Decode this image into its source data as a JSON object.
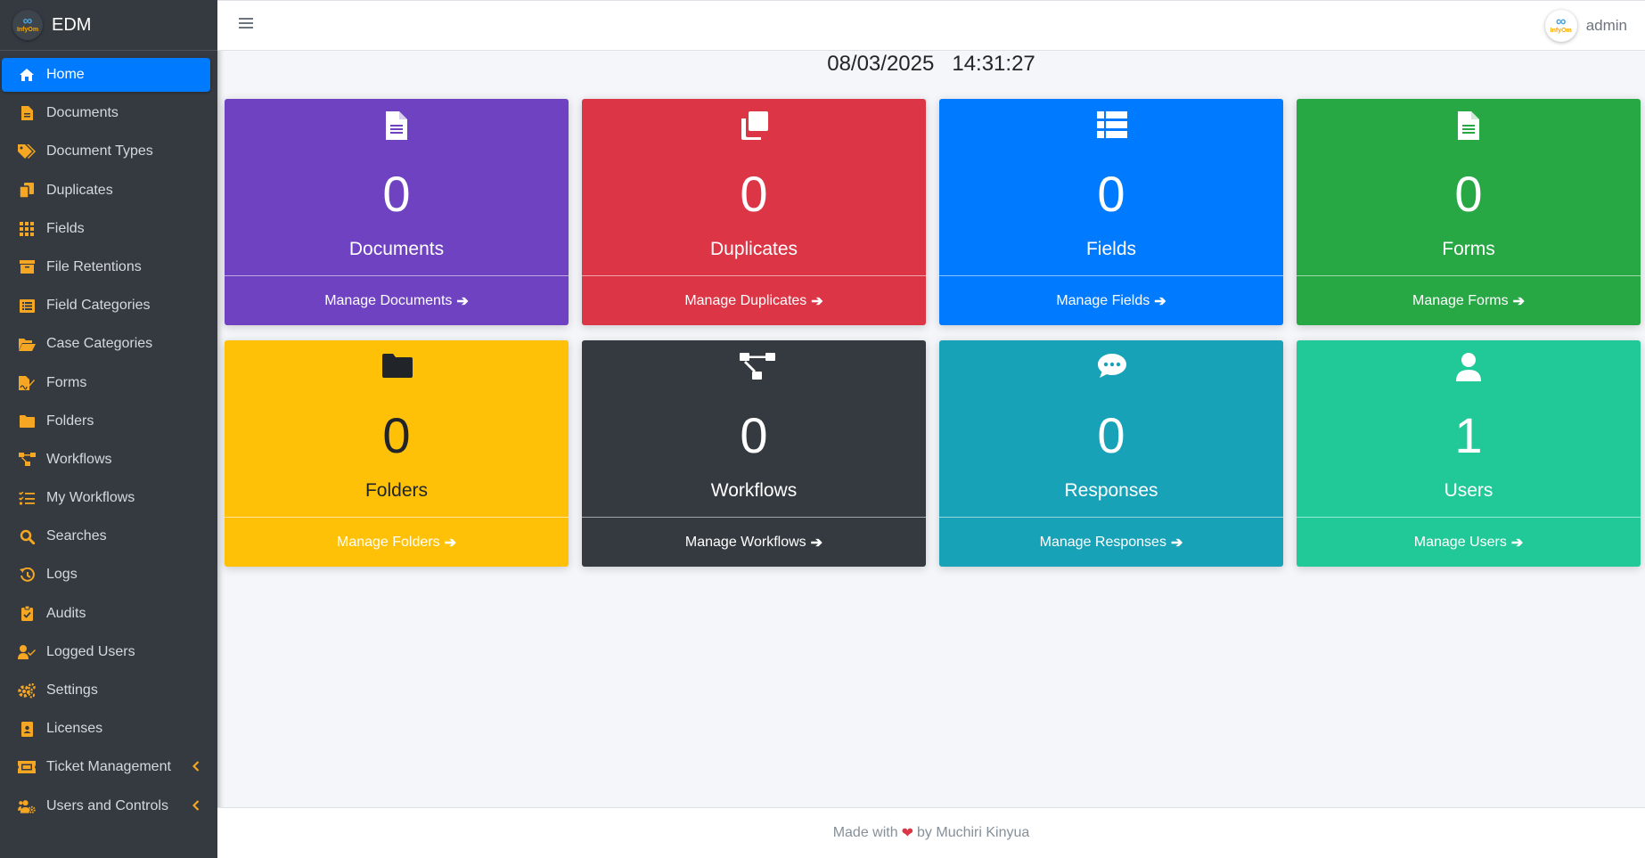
{
  "brand": {
    "name": "EDM",
    "logo_text": "InfyOm"
  },
  "sidebar": {
    "items": [
      {
        "label": "Home",
        "icon": "home-icon",
        "active": true
      },
      {
        "label": "Documents",
        "icon": "file-icon"
      },
      {
        "label": "Document Types",
        "icon": "tags-icon"
      },
      {
        "label": "Duplicates",
        "icon": "copy-icon"
      },
      {
        "label": "Fields",
        "icon": "grid-icon"
      },
      {
        "label": "File Retentions",
        "icon": "archive-icon"
      },
      {
        "label": "Field Categories",
        "icon": "list-alt-icon"
      },
      {
        "label": "Case Categories",
        "icon": "folder-open-icon"
      },
      {
        "label": "Forms",
        "icon": "file-signature-icon"
      },
      {
        "label": "Folders",
        "icon": "folder-icon"
      },
      {
        "label": "Workflows",
        "icon": "sitemap-icon"
      },
      {
        "label": "My Workflows",
        "icon": "tasks-icon"
      },
      {
        "label": "Searches",
        "icon": "search-icon"
      },
      {
        "label": "Logs",
        "icon": "history-icon"
      },
      {
        "label": "Audits",
        "icon": "clipboard-check-icon"
      },
      {
        "label": "Logged Users",
        "icon": "user-check-icon"
      },
      {
        "label": "Settings",
        "icon": "cogs-icon"
      },
      {
        "label": "Licenses",
        "icon": "id-badge-icon"
      },
      {
        "label": "Ticket Management",
        "icon": "ticket-icon",
        "has_children": true
      },
      {
        "label": "Users and Controls",
        "icon": "users-cog-icon",
        "has_children": true
      }
    ]
  },
  "topbar": {
    "user_name": "admin"
  },
  "datetime": {
    "date": "08/03/2025",
    "time": "14:31:27"
  },
  "cards": [
    {
      "count": "0",
      "title": "Documents",
      "link": "Manage Documents",
      "icon": "file-icon",
      "color": "#6f42c1"
    },
    {
      "count": "0",
      "title": "Duplicates",
      "link": "Manage Duplicates",
      "icon": "copy-icon",
      "color": "#dc3545"
    },
    {
      "count": "0",
      "title": "Fields",
      "link": "Manage Fields",
      "icon": "list-icon",
      "color": "#007bff"
    },
    {
      "count": "0",
      "title": "Forms",
      "link": "Manage Forms",
      "icon": "file-icon",
      "color": "#28a745"
    },
    {
      "count": "0",
      "title": "Folders",
      "link": "Manage Folders",
      "icon": "folder-icon",
      "color": "#ffc107"
    },
    {
      "count": "0",
      "title": "Workflows",
      "link": "Manage Workflows",
      "icon": "sitemap-icon",
      "color": "#343a40"
    },
    {
      "count": "0",
      "title": "Responses",
      "link": "Manage Responses",
      "icon": "comment-dots-icon",
      "color": "#17a2b8"
    },
    {
      "count": "1",
      "title": "Users",
      "link": "Manage Users",
      "icon": "user-icon",
      "color": "#20c997"
    }
  ],
  "footer": {
    "prefix": "Made with",
    "suffix": "by Muchiri Kinyua"
  },
  "colors": {
    "sidebar_bg": "#343a40",
    "accent": "#007bff",
    "icon_orange": "#f5a623",
    "heart": "#dc3545"
  }
}
